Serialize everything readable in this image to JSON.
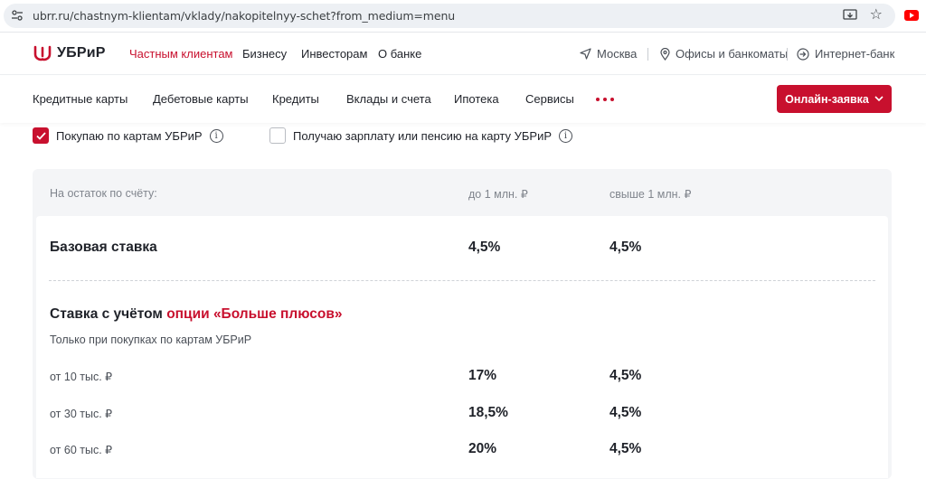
{
  "browser": {
    "url": "ubrr.ru/chastnym-klientam/vklady/nakopitelnyy-schet?from_medium=menu"
  },
  "brand": {
    "name": "УБРиР",
    "accent": "#c8102e"
  },
  "topnav": {
    "items": [
      "Частным клиентам",
      "Бизнесу",
      "Инвесторам",
      "О банке"
    ],
    "city": "Москва",
    "offices": "Офисы и банкоматы",
    "ibank": "Интернет-банк"
  },
  "subnav": {
    "items": [
      "Кредитные карты",
      "Дебетовые карты",
      "Кредиты",
      "Вклады и счета",
      "Ипотека",
      "Сервисы"
    ],
    "apply_label": "Онлайн-заявка"
  },
  "filters": {
    "buy_cards": {
      "label": "Покупаю по картам УБРиР",
      "checked": true
    },
    "salary": {
      "label": "Получаю зарплату или пенсию на карту УБРиР",
      "checked": false
    }
  },
  "table": {
    "header": [
      "На остаток по счёту:",
      "до 1 млн. ₽",
      "свыше 1 млн. ₽"
    ],
    "base": {
      "label": "Базовая ставка",
      "values": [
        "4,5%",
        "4,5%"
      ]
    },
    "option": {
      "title_prefix": "Ставка с учётом ",
      "title_link": "опции «Больше плюсов»",
      "note": "Только при покупках по картам УБРиР",
      "rows": [
        {
          "label": "от 10 тыс. ₽",
          "values": [
            "17%",
            "4,5%"
          ]
        },
        {
          "label": "от 30 тыс. ₽",
          "values": [
            "18,5%",
            "4,5%"
          ]
        },
        {
          "label": "от 60 тыс. ₽",
          "values": [
            "20%",
            "4,5%"
          ]
        }
      ]
    }
  }
}
